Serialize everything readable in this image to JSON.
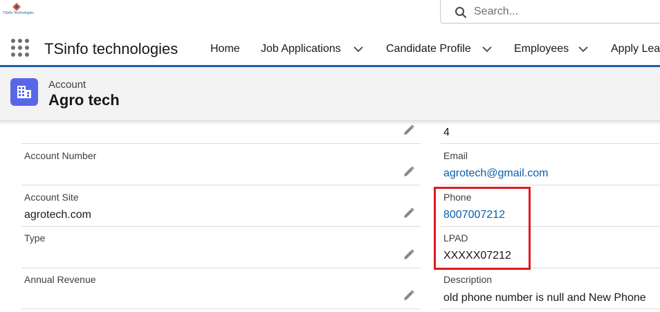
{
  "logo": {
    "text": "TSinfo Technologies"
  },
  "search": {
    "placeholder": "Search..."
  },
  "nav": {
    "app_name": "TSinfo technologies",
    "items": [
      {
        "label": "Home",
        "has_menu": false
      },
      {
        "label": "Job Applications",
        "has_menu": true
      },
      {
        "label": "Candidate Profile",
        "has_menu": true
      },
      {
        "label": "Employees",
        "has_menu": true
      },
      {
        "label": "Apply Leave",
        "has_menu": false
      }
    ]
  },
  "record": {
    "object_type": "Account",
    "name": "Agro tech"
  },
  "left_fields": [
    {
      "label": "",
      "value": ""
    },
    {
      "label": "Account Number",
      "value": ""
    },
    {
      "label": "Account Site",
      "value": "agrotech.com"
    },
    {
      "label": "Type",
      "value": ""
    },
    {
      "label": "Annual Revenue",
      "value": ""
    }
  ],
  "right_fields": [
    {
      "label": "",
      "value": "4"
    },
    {
      "label": "Email",
      "value": "agrotech@gmail.com"
    },
    {
      "label": "Phone",
      "value": "8007007212"
    },
    {
      "label": "LPAD",
      "value": "XXXXX07212"
    },
    {
      "label": "Description",
      "value": "old phone number is null and New Phone"
    }
  ],
  "colors": {
    "brand_blue": "#1b5fa8",
    "link": "#0b5cab",
    "account_icon": "#5867e8",
    "highlight": "#e0191f"
  }
}
